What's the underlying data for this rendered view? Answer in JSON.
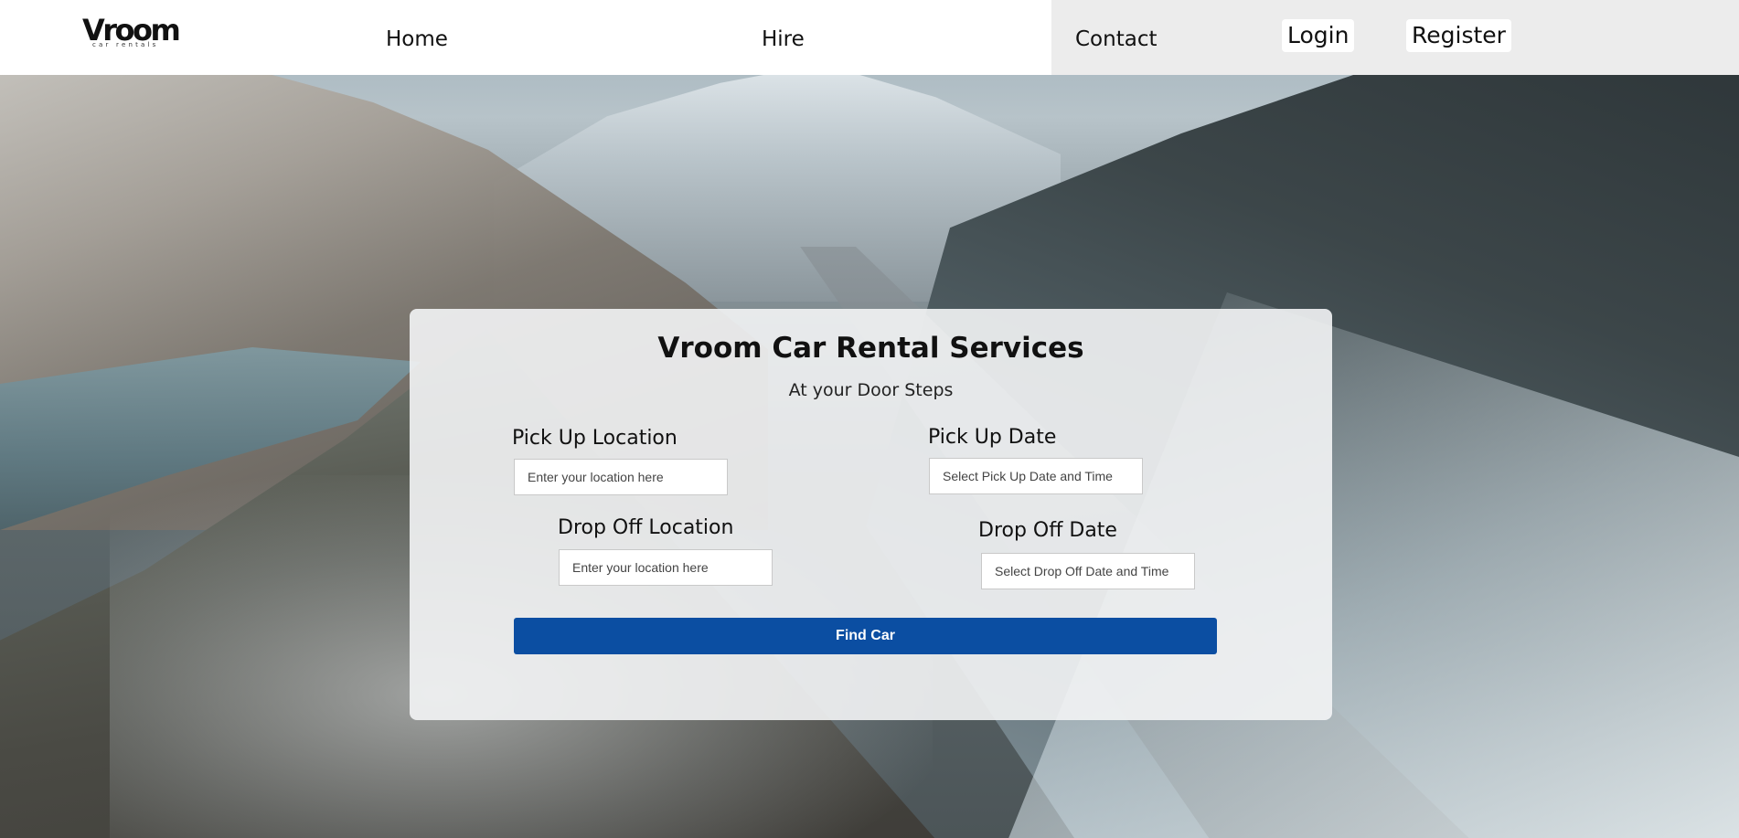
{
  "header": {
    "logo": {
      "word": "Vroom",
      "tagline": "car rentals"
    },
    "nav": {
      "home": "Home",
      "hire": "Hire",
      "contact": "Contact",
      "login": "Login",
      "register": "Register"
    }
  },
  "booking": {
    "title": "Vroom Car Rental Services",
    "subtitle": "At your Door Steps",
    "pickup_location": {
      "label": "Pick Up Location",
      "placeholder": "Enter your location here"
    },
    "dropoff_location": {
      "label": "Drop Off Location",
      "placeholder": "Enter your location here"
    },
    "pickup_date": {
      "label": "Pick Up Date",
      "placeholder": "Select Pick Up Date and Time"
    },
    "dropoff_date": {
      "label": "Drop Off Date",
      "placeholder": "Select Drop Off Date and Time"
    },
    "submit_label": "Find Car"
  },
  "colors": {
    "primary_button": "#0b4ea2",
    "header_left": "#ffffff",
    "header_right": "#ececec"
  }
}
